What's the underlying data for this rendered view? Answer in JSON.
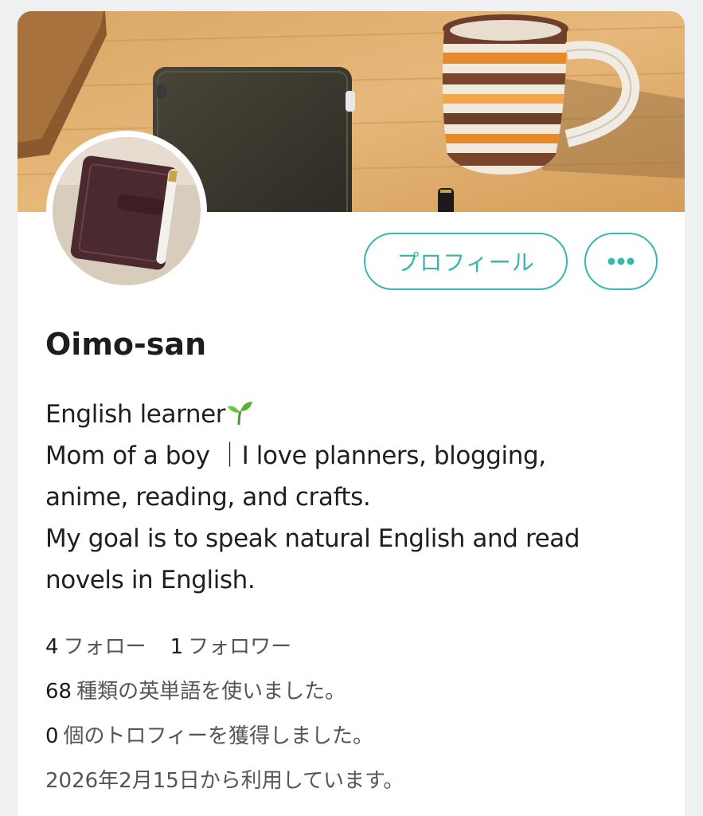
{
  "profile": {
    "name": "Oimo-san",
    "bio_lines": [
      "English learner",
      "Mom of a boy ｜I love planners, blogging,",
      "anime, reading, and crafts.",
      "My goal is to speak natural English and read",
      "novels in English."
    ],
    "bio_emoji_icon": "seedling-icon"
  },
  "actions": {
    "profile_label": "プロフィール",
    "more_icon": "more-dots-icon"
  },
  "stats": {
    "follow_count": "4",
    "follow_label": "フォロー",
    "follower_count": "1",
    "follower_label": "フォロワー",
    "words_count": "68",
    "words_label": "種類の英単語を使いました。",
    "trophy_count": "0",
    "trophy_label": "個のトロフィーを獲得しました。",
    "since_label": "2026年2月15日から利用しています。"
  },
  "colors": {
    "accent": "#37b8ad",
    "background": "#eef0f1",
    "card": "#ffffff"
  }
}
